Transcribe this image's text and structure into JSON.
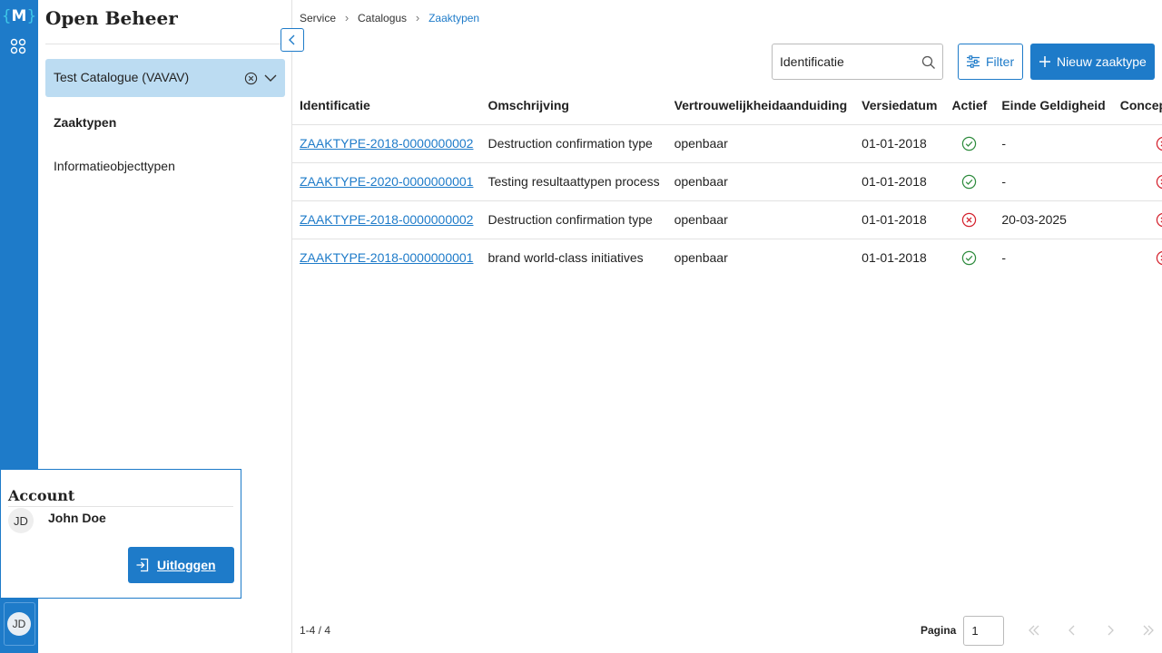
{
  "app": {
    "title": "Open Beheer",
    "rail_logo_letter": "M",
    "user_initials": "JD"
  },
  "sidebar": {
    "catalog_value": "Test Catalogue (VAVAV)",
    "items": [
      {
        "label": "Zaaktypen",
        "active": true
      },
      {
        "label": "Informatieobjecttypen",
        "active": false
      }
    ]
  },
  "account": {
    "title": "Account",
    "initials": "JD",
    "name": "John Doe",
    "logout_label": "Uitloggen"
  },
  "breadcrumbs": [
    "Service",
    "Catalogus",
    "Zaaktypen"
  ],
  "toolbar": {
    "search_value": "Identificatie",
    "filter_label": "Filter",
    "new_label": "Nieuw zaaktype"
  },
  "table": {
    "columns": [
      "Identificatie",
      "Omschrijving",
      "Vertrouwelijkheidaanduiding",
      "Versiedatum",
      "Actief",
      "Einde Geldigheid",
      "Concept"
    ],
    "rows": [
      {
        "id": "ZAAKTYPE-2018-0000000002",
        "omschrijving": "Destruction confirmation type",
        "vertrouwelijkheid": "openbaar",
        "versiedatum": "01-01-2018",
        "actief": true,
        "einde": "-",
        "concept": false
      },
      {
        "id": "ZAAKTYPE-2020-0000000001",
        "omschrijving": "Testing resultaattypen process",
        "vertrouwelijkheid": "openbaar",
        "versiedatum": "01-01-2018",
        "actief": true,
        "einde": "-",
        "concept": false
      },
      {
        "id": "ZAAKTYPE-2018-0000000002",
        "omschrijving": "Destruction confirmation type",
        "vertrouwelijkheid": "openbaar",
        "versiedatum": "01-01-2018",
        "actief": false,
        "einde": "20-03-2025",
        "concept": false
      },
      {
        "id": "ZAAKTYPE-2018-0000000001",
        "omschrijving": "brand world-class initiatives",
        "vertrouwelijkheid": "openbaar",
        "versiedatum": "01-01-2018",
        "actief": true,
        "einde": "-",
        "concept": false
      }
    ]
  },
  "pagination": {
    "count_label": "1-4 / 4",
    "page_label": "Pagina",
    "page_value": "1"
  },
  "colors": {
    "primary": "#1e7bc9",
    "selected_bg": "#bcdcf2",
    "success": "#2e8b3d",
    "danger": "#d4202c"
  },
  "icons": {
    "apps": "apps-grid-icon",
    "collapse": "chevron-left-icon",
    "clear": "circle-x-icon",
    "dropdown": "chevron-down-icon",
    "search": "search-icon",
    "filter": "sliders-icon",
    "new": "plus-icon",
    "logout": "login-icon",
    "true": "check-circle-icon",
    "false": "x-circle-icon",
    "first": "double-chevron-left-icon",
    "prev": "chevron-left-icon",
    "next": "chevron-right-icon",
    "last": "double-chevron-right-icon"
  }
}
